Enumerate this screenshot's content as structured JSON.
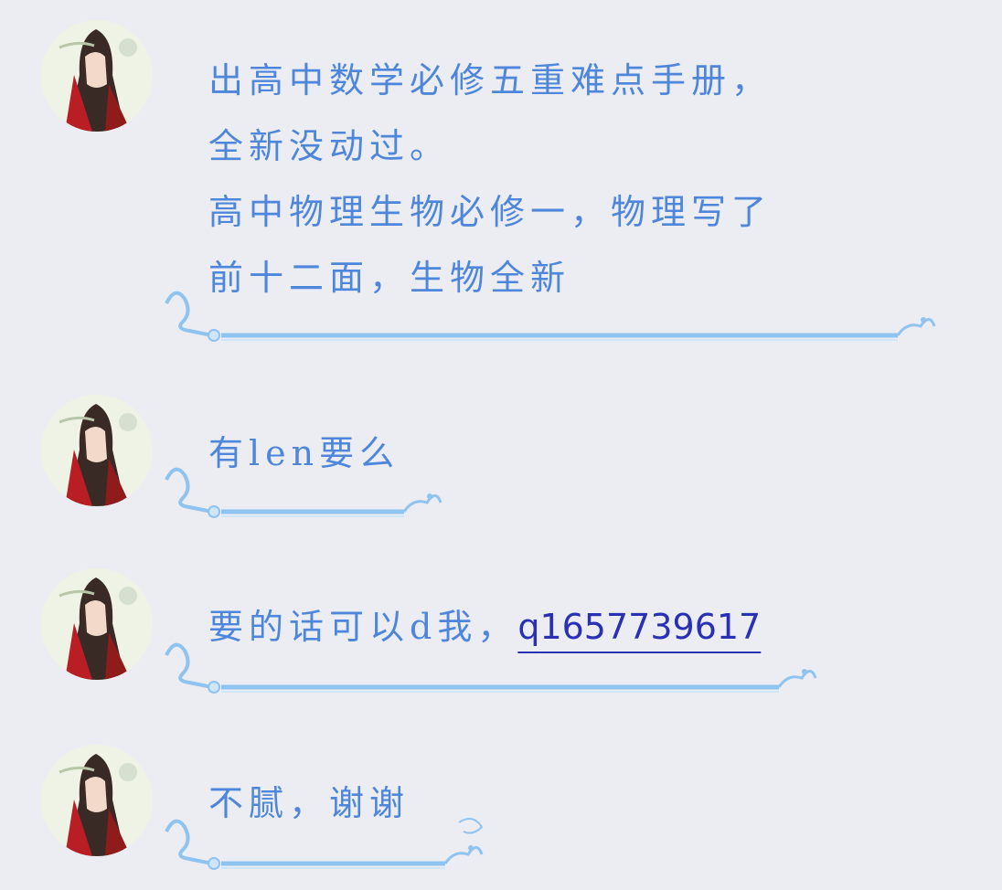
{
  "messages": [
    {
      "lines": [
        "出高中数学必修五重难点手册，",
        "全新没动过。",
        "高中物理生物必修一，物理写了",
        "前十二面，生物全新"
      ]
    },
    {
      "lines": [
        "有len要么"
      ]
    },
    {
      "text": "要的话可以d我，",
      "qq_prefix": "q",
      "qq_number": "1657739617"
    },
    {
      "lines": [
        "不腻，谢谢"
      ]
    }
  ],
  "colors": {
    "text": "#4d86da",
    "link": "#2a30b4",
    "background": "#ecedf2",
    "bubble_deco": "#8fc3f0"
  },
  "icons": {
    "avatar": "user-avatar-icon",
    "bubble_decoration": "wave-bubble-decoration-icon"
  }
}
